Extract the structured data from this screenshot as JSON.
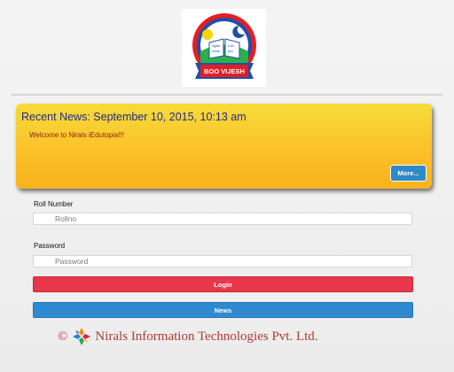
{
  "logo": {
    "label": "BOO VIJESH",
    "book_text": [
      "Sgate",
      "h,dn",
      "mhds",
      "yeo"
    ]
  },
  "news": {
    "title": "Recent News: September 10, 2015, 10:13 am",
    "message": "Welcome to Nirals iEdutopia!!!",
    "more_label": "More..."
  },
  "form": {
    "roll_label": "Roll Number",
    "roll_placeholder": "Rollno",
    "password_label": "Password",
    "password_placeholder": "Password",
    "login_label": "Login",
    "news_label": "News"
  },
  "footer": {
    "copyright": "©",
    "company": "Nirals Information Technologies Pvt. Ltd."
  },
  "colors": {
    "login": "#e8374a",
    "news_button": "#2f8ad0",
    "news_panel": "#f9c82b",
    "title": "#202a8a"
  }
}
